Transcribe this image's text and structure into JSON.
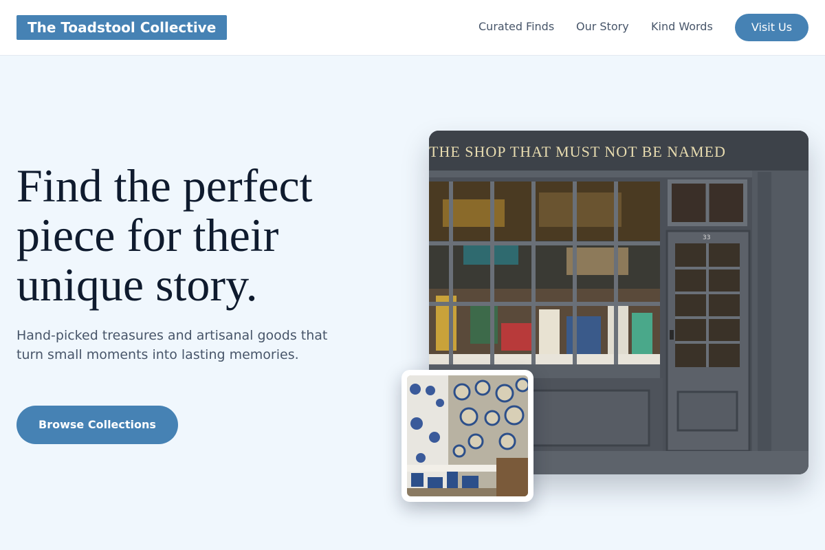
{
  "header": {
    "brand": "The Toadstool Collective",
    "nav": [
      "Curated Finds",
      "Our Story",
      "Kind Words"
    ],
    "visit_label": "Visit Us"
  },
  "hero": {
    "title": "Find the perfect piece for their unique story.",
    "subtitle": "Hand-picked treasures and artisanal goods that turn small moments into lasting memories.",
    "cta_label": "Browse Collections"
  },
  "images": {
    "shop_sign": "THE SHOP THAT MUST NOT BE NAMED",
    "door_number": "33"
  },
  "colors": {
    "accent": "#4682b4",
    "background": "#f0f7fd",
    "heading": "#0f1b2e",
    "body_text": "#475569"
  }
}
